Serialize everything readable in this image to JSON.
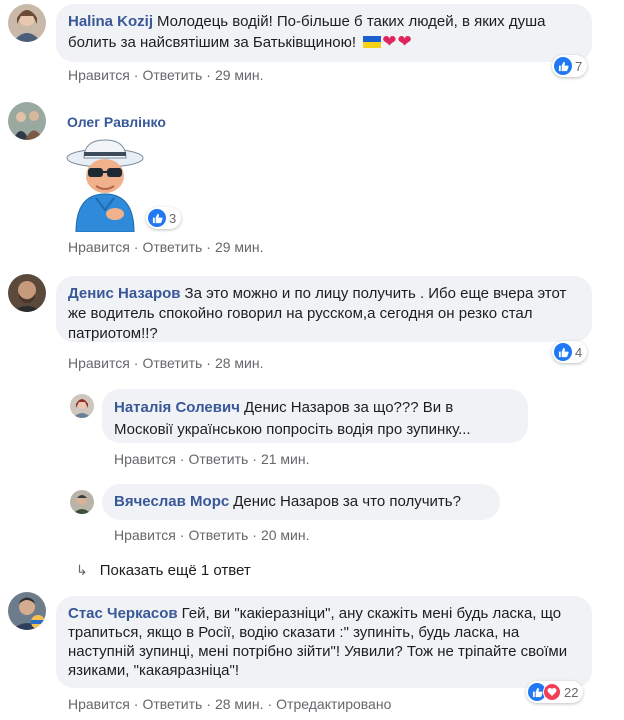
{
  "actions": {
    "like": "Нравится",
    "reply": "Ответить",
    "edited": "Отредактировано",
    "separator": "·"
  },
  "comments": [
    {
      "author": "Halina Kozij",
      "text": "Молодець водій! По-більше б таких людей, в яких душа болить за найсвятішим за Батьківщиною!",
      "emoji": [
        "ukraine-flag-icon",
        "heart-icon",
        "heart-icon"
      ],
      "time": "29 мин.",
      "reactions": "7"
    },
    {
      "author": "Олег Равлінко",
      "sticker": "cool-grandpa-sticker",
      "time": "29 мин.",
      "reactions": "3"
    },
    {
      "author": "Денис Назаров",
      "text": "За это можно и по лицу получить . Ибо еще вчера этот же водитель спокойно говорил на русском,а сегодня он резко стал патриотом!!?",
      "time": "28 мин.",
      "reactions": "4"
    },
    {
      "author": "Наталія Солевич",
      "mention": "Денис Назаров",
      "text": "за що??? Ви в Московії українською попросіть водія про зупинку...",
      "time": "21 мин."
    },
    {
      "author": "Вячеслав Морс",
      "mention": "Денис Назаров",
      "text": "за что получить?",
      "time": "20 мин."
    },
    {
      "author": "Стас Черкасов",
      "text": "Гей, ви \"какіеразніци\", ану скажіть мені будь ласка, що трапиться, якщо в Росії, водію сказати :\" зупиніть, будь ласка, на наступній зупинці, мені потрібно зійти\"! Уявили? Тож не тріпайте своїми язиками, \"какаяразніца\"!",
      "time": "28 мин.",
      "reactions": "22"
    }
  ],
  "show_more": "Показать ещё 1 ответ",
  "colors": {
    "bubble": "#f0f2f5",
    "author": "#385898",
    "meta": "#65676b",
    "like": "#2078f4",
    "love": "#f33e58"
  }
}
